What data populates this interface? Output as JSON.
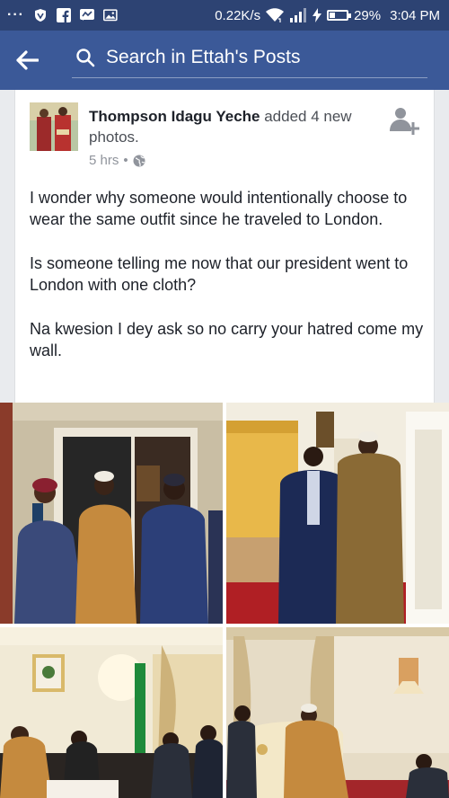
{
  "status_bar": {
    "speed": "0.22K/s",
    "battery": "29%",
    "battery_level": 0.29,
    "time": "3:04 PM"
  },
  "app_bar": {
    "back_icon": "arrow-left-icon",
    "search_icon": "search-icon",
    "search_placeholder": "Search in Ettah's Posts"
  },
  "post": {
    "author": "Thompson Idagu Yeche",
    "action": " added 4 new photos.",
    "time": "5 hrs",
    "privacy_icon": "globe-icon",
    "paragraphs": [
      "I wonder why someone would intentionally choose to wear the same outfit since he traveled to London.",
      "Is someone telling me now that our president went to London with one cloth?",
      "Na kwesion I dey ask so no carry your hatred come my wall."
    ]
  },
  "colors": {
    "brand": "#3b5998",
    "status_bar": "#2d4373",
    "meta_text": "#90949c"
  }
}
